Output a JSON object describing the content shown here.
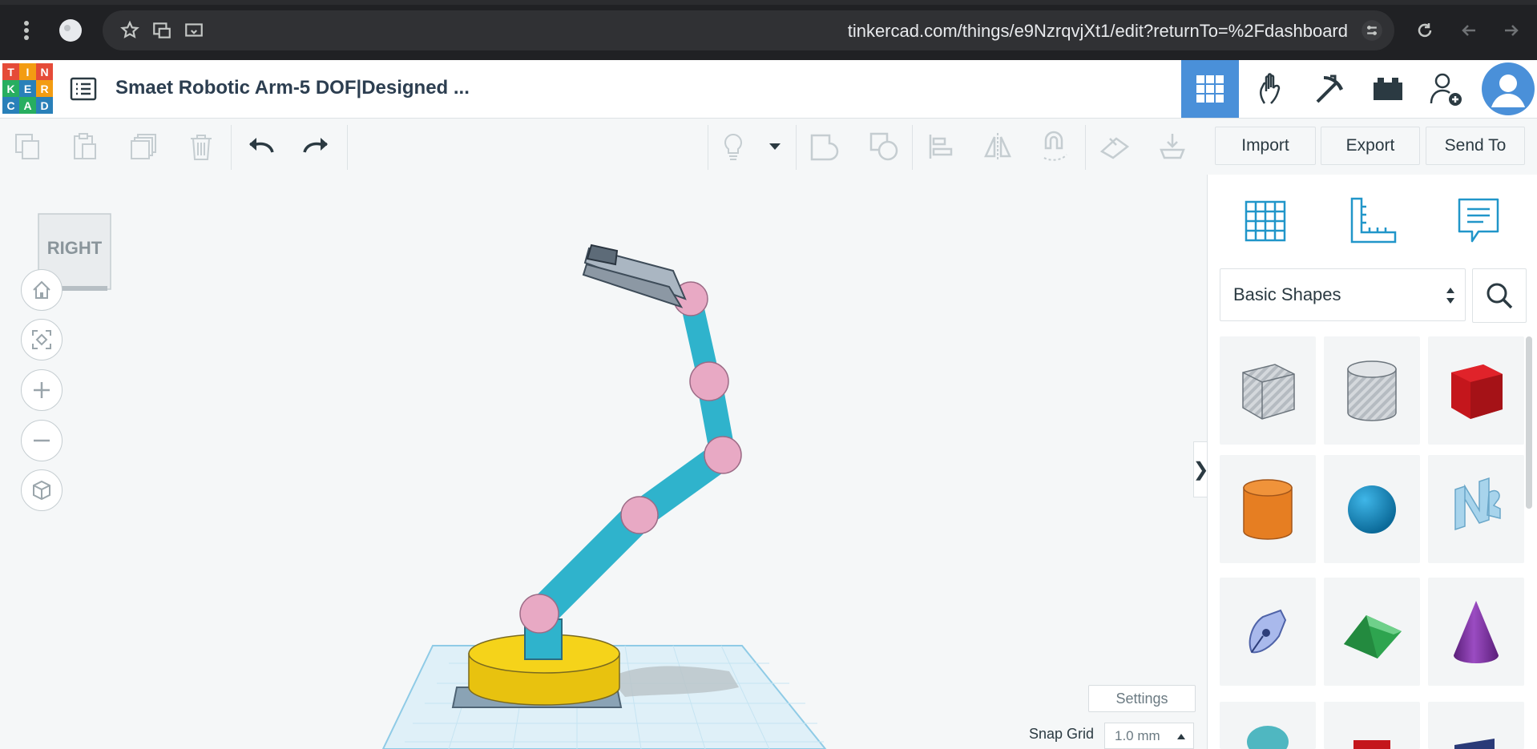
{
  "browser": {
    "url": "tinkercad.com/things/e9NzrqvjXt1/edit?returnTo=%2Fdashboard",
    "icons": [
      "menu-dots-icon",
      "profile-icon",
      "star-icon",
      "translate-icon",
      "cast-icon",
      "tune-icon",
      "reload-icon",
      "back-icon",
      "forward-icon"
    ]
  },
  "app": {
    "logo_letters": [
      "T",
      "I",
      "N",
      "K",
      "E",
      "R",
      "C",
      "A",
      "D"
    ],
    "logo_colors": [
      "#e54b38",
      "#f39c12",
      "#e54b38",
      "#27ae60",
      "#2980b9",
      "#f39c12",
      "#2980b9",
      "#27ae60",
      "#2980b9"
    ],
    "title": "Smaet Robotic Arm-5 DOF|Designed ...",
    "accent": "#4a90d9"
  },
  "toolbar": {
    "import_label": "Import",
    "export_label": "Export",
    "send_label": "Send To"
  },
  "workspace": {
    "viewcube_label": "RIGHT",
    "settings_label": "Settings",
    "snap_label": "Snap Grid",
    "snap_value": "1.0 mm",
    "collapse_glyph": "❯"
  },
  "panel": {
    "category": "Basic Shapes",
    "shapes": [
      "box-striped",
      "cylinder-striped",
      "box",
      "cylinder",
      "sphere",
      "text",
      "scribble",
      "roof",
      "cone"
    ]
  }
}
